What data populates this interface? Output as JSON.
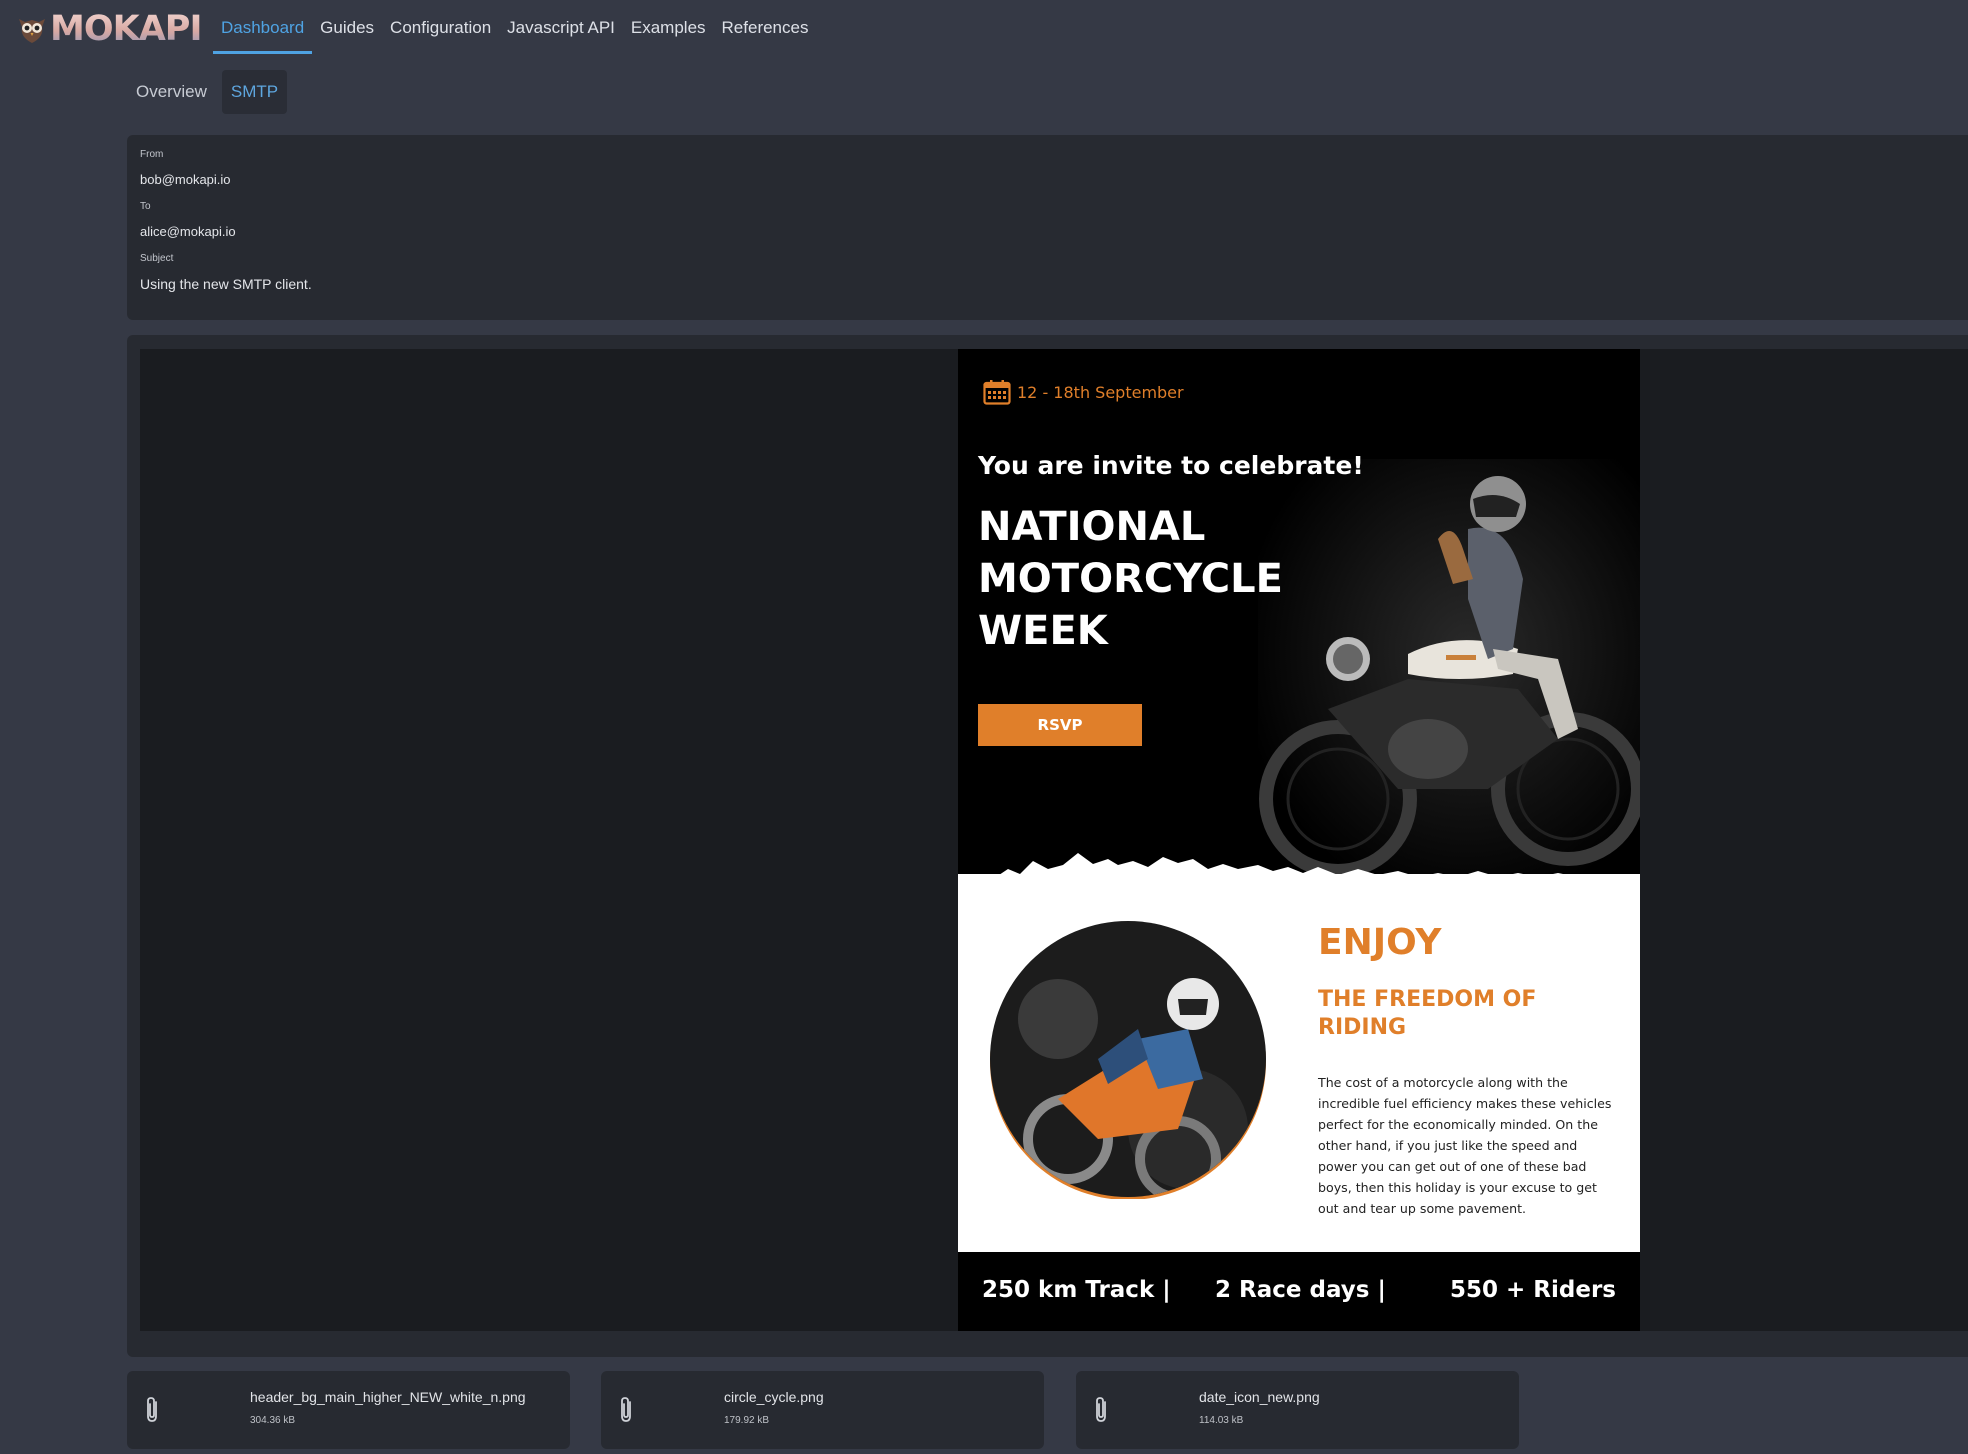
{
  "app": {
    "logo_text": "MOKAPI"
  },
  "nav": {
    "items": [
      {
        "label": "Dashboard",
        "active": true
      },
      {
        "label": "Guides"
      },
      {
        "label": "Configuration"
      },
      {
        "label": "Javascript API"
      },
      {
        "label": "Examples"
      },
      {
        "label": "References"
      }
    ]
  },
  "subnav": {
    "items": [
      {
        "label": "Overview"
      },
      {
        "label": "SMTP",
        "active": true
      }
    ]
  },
  "mail": {
    "from_label": "From",
    "from": "bob@mokapi.io",
    "to_label": "To",
    "to": "alice@mokapi.io",
    "subject_label": "Subject",
    "subject": "Using the new SMTP client."
  },
  "email": {
    "date": "12 - 18th September",
    "invite": "You are invite to celebrate!",
    "title_lines": [
      "NATIONAL",
      "MOTORCYCLE",
      "WEEK"
    ],
    "rsvp": "RSVP",
    "enjoy": "ENJOY",
    "freedom": "THE FREEDOM OF RIDING",
    "description": "The cost of a motorcycle along with the incredible fuel efficiency makes these vehicles perfect for the economically minded. On the other hand, if you just like the speed and power you can get out of one of these bad boys, then this holiday is your excuse to get out and tear up some pavement.",
    "stats": [
      "250 km Track  |",
      "2 Race days  |",
      "550 + Riders"
    ],
    "accent_color": "#e07f2a"
  },
  "attachments": [
    {
      "name": "header_bg_main_higher_NEW_white_n.png",
      "size": "304.36 kB",
      "icon": "paperclip-icon"
    },
    {
      "name": "circle_cycle.png",
      "size": "179.92 kB",
      "icon": "paperclip-icon"
    },
    {
      "name": "date_icon_new.png",
      "size": "114.03 kB",
      "icon": "paperclip-icon"
    }
  ],
  "colors": {
    "background": "#353945",
    "panel": "#272a31",
    "active_link": "#4fa3e3"
  }
}
